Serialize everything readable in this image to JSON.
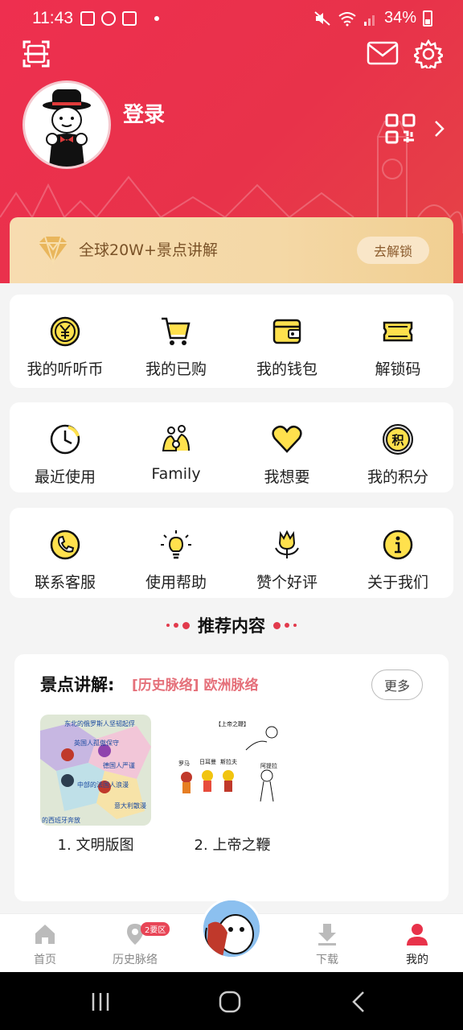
{
  "status_bar": {
    "time": "11:43",
    "battery": "34%"
  },
  "profile": {
    "login_label": "登录"
  },
  "vip": {
    "text": "全球20W+景点讲解",
    "button": "去解锁"
  },
  "grid_row1": [
    {
      "label": "我的听听币",
      "icon": "coin-icon"
    },
    {
      "label": "我的已购",
      "icon": "cart-icon"
    },
    {
      "label": "我的钱包",
      "icon": "wallet-icon"
    },
    {
      "label": "解锁码",
      "icon": "ticket-icon"
    }
  ],
  "grid_row2": [
    {
      "label": "最近使用",
      "icon": "clock-icon"
    },
    {
      "label": "Family",
      "icon": "family-icon"
    },
    {
      "label": "我想要",
      "icon": "heart-icon"
    },
    {
      "label": "我的积分",
      "icon": "points-icon",
      "glyph": "积"
    }
  ],
  "grid_row3": [
    {
      "label": "联系客服",
      "icon": "phone-icon"
    },
    {
      "label": "使用帮助",
      "icon": "bulb-icon"
    },
    {
      "label": "赞个好评",
      "icon": "flower-icon"
    },
    {
      "label": "关于我们",
      "icon": "info-icon"
    }
  ],
  "section": {
    "title": "推荐内容"
  },
  "recommend": {
    "label": "景点讲解:",
    "tags": "[历史脉络] 欧洲脉络",
    "more": "更多",
    "items": [
      {
        "title": "1. 文明版图",
        "thumb_texts": [
          "东北的俄罗斯人坚韧起俘",
          "英国人孤傲保守",
          "德国人严谨",
          "中部的法国人浪漫",
          "意大利散漫",
          "的西班牙奔放"
        ]
      },
      {
        "title": "2. 上帝之鞭",
        "thumb_texts": [
          "【上帝之鞭】",
          "罗马",
          "日耳曼",
          "斯拉夫",
          "阿提拉"
        ]
      }
    ]
  },
  "bottom_nav": {
    "items": [
      {
        "label": "首页",
        "icon": "home-icon"
      },
      {
        "label": "历史脉络",
        "icon": "location-icon",
        "badge": "2要区"
      },
      {
        "label": "下载",
        "icon": "download-icon"
      },
      {
        "label": "我的",
        "icon": "person-icon"
      }
    ]
  },
  "colors": {
    "brand_red": "#e8324a",
    "gold": "#f2d59f",
    "icon_yellow": "#ffe14d"
  }
}
